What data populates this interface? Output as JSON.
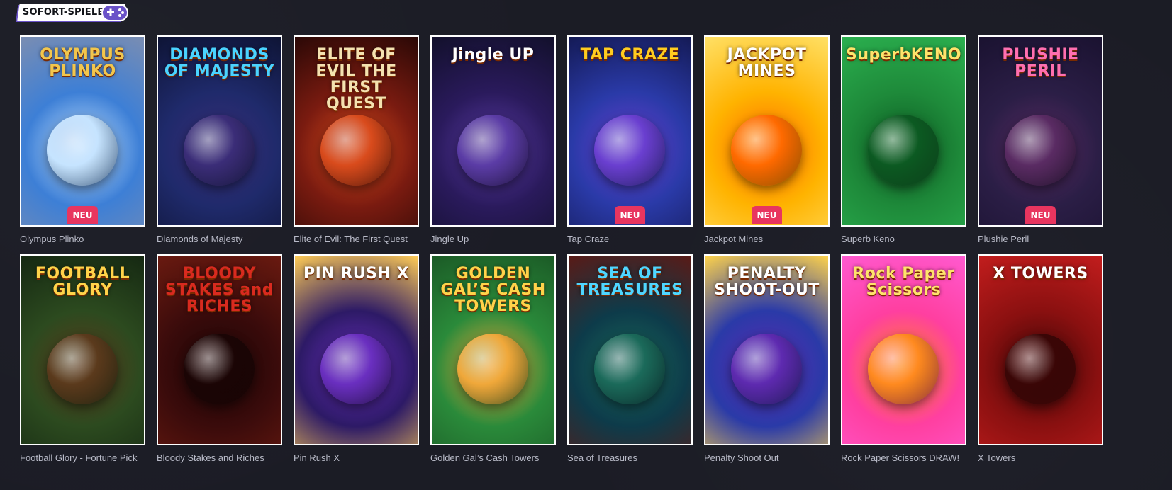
{
  "section": {
    "title": "SOFORT-SPIELE",
    "icon": "gamepad-icon"
  },
  "badge_label": "NEU",
  "games": [
    {
      "name": "Olympus Plinko",
      "logo": "OLYMPUS PLINKO",
      "new": true,
      "colors": [
        "#3d7fd6",
        "#c6e4ff",
        "#7a8db2"
      ],
      "logo_color": "#f2c64d"
    },
    {
      "name": "Diamonds of Majesty",
      "logo": "DIAMONDS OF MAJESTY",
      "new": false,
      "colors": [
        "#1f2a6b",
        "#3b2d78",
        "#0e1435"
      ],
      "logo_color": "#4ad3ff"
    },
    {
      "name": "Elite of Evil: The First Quest",
      "logo": "ELITE OF EVIL THE FIRST QUEST",
      "new": false,
      "colors": [
        "#7a1b10",
        "#d94b1c",
        "#2a0806"
      ],
      "logo_color": "#f4e2b0"
    },
    {
      "name": "Jingle Up",
      "logo": "Jingle UP",
      "new": false,
      "colors": [
        "#2a1a5c",
        "#5b3ca6",
        "#12102b"
      ],
      "logo_color": "#ffffff"
    },
    {
      "name": "Tap Craze",
      "logo": "TAP CRAZE",
      "new": true,
      "colors": [
        "#2a3aa8",
        "#6a3fd0",
        "#141a55"
      ],
      "logo_color": "#ffcc1f"
    },
    {
      "name": "Jackpot Mines",
      "logo": "JACKPOT MINES",
      "new": true,
      "colors": [
        "#ffb300",
        "#ff6a00",
        "#ffe066"
      ],
      "logo_color": "#ffffff"
    },
    {
      "name": "Superb Keno",
      "logo": "SuperbKENO",
      "new": false,
      "colors": [
        "#1e8a3a",
        "#0c5a22",
        "#2bb04f"
      ],
      "logo_color": "#ffe36b"
    },
    {
      "name": "Plushie Peril",
      "logo": "PLUSHIE PERIL",
      "new": true,
      "colors": [
        "#2b1e46",
        "#5a2b63",
        "#1a1230"
      ],
      "logo_color": "#ff6fb0"
    },
    {
      "name": "Football Glory - Fortune Pick",
      "logo": "FOOTBALL GLORY",
      "new": false,
      "colors": [
        "#2c4a1f",
        "#5b3a1c",
        "#152812"
      ],
      "logo_color": "#ffd34a"
    },
    {
      "name": "Bloody Stakes and Riches",
      "logo": "BLOODY STAKES and RICHES",
      "new": false,
      "colors": [
        "#3a0b0b",
        "#1b0505",
        "#6a1a10"
      ],
      "logo_color": "#d92a1f"
    },
    {
      "name": "Pin Rush X",
      "logo": "PIN RUSH X",
      "new": false,
      "colors": [
        "#2d1a66",
        "#6a2fc0",
        "#ffcc55"
      ],
      "logo_color": "#ffffff"
    },
    {
      "name": "Golden Gal’s Cash Towers",
      "logo": "GOLDEN GAL’S CASH TOWERS",
      "new": false,
      "colors": [
        "#2a8a3a",
        "#f0a83a",
        "#1b5a26"
      ],
      "logo_color": "#ffd34a"
    },
    {
      "name": "Sea of Treasures",
      "logo": "SEA OF TREASURES",
      "new": false,
      "colors": [
        "#0d3b4a",
        "#1b6a5a",
        "#5a1a16"
      ],
      "logo_color": "#4fd6ff"
    },
    {
      "name": "Penalty Shoot Out",
      "logo": "PENALTY SHOOT-OUT",
      "new": false,
      "colors": [
        "#2a3aa8",
        "#5e2ab0",
        "#ffd34a"
      ],
      "logo_color": "#ffffff"
    },
    {
      "name": "Rock Paper Scissors DRAW!",
      "logo": "Rock Paper Scissors",
      "new": false,
      "colors": [
        "#ff3fa0",
        "#ff8a1f",
        "#ff5ad0"
      ],
      "logo_color": "#ffe36b"
    },
    {
      "name": "X Towers",
      "logo": "X TOWERS",
      "new": false,
      "colors": [
        "#8a1010",
        "#3a0606",
        "#c21d1d"
      ],
      "logo_color": "#ffffff"
    }
  ]
}
